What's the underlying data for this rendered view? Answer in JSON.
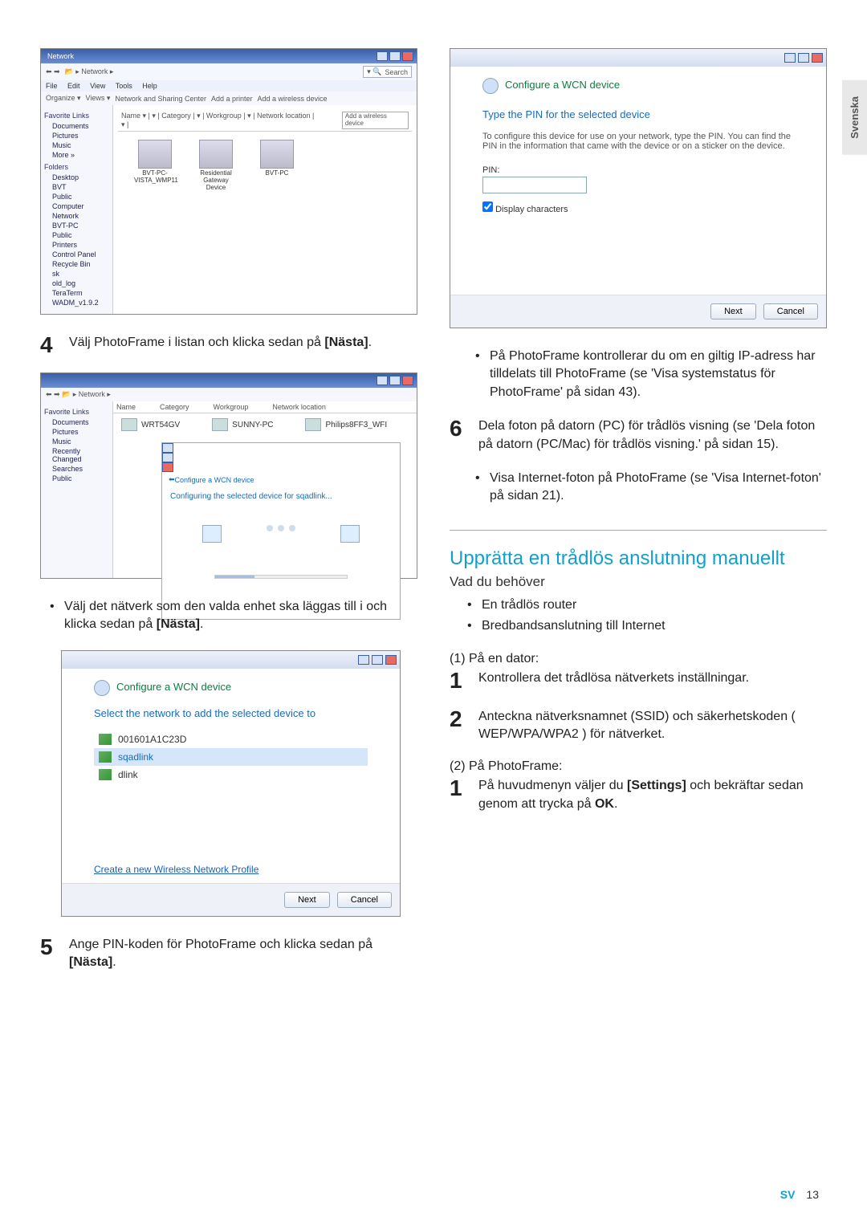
{
  "sidetab": "Svenska",
  "footer": {
    "lang": "SV",
    "page": "13"
  },
  "shot1": {
    "windowtitle": "Network",
    "menubar": [
      "File",
      "Edit",
      "View",
      "Tools",
      "Help"
    ],
    "toolbar_extra": [
      "Organize ▾",
      "Views ▾",
      "Network and Sharing Center",
      "Add a printer",
      "Add a wireless device"
    ],
    "search_placeholder": "Search",
    "headercols": "Name  ▾ | ▾ | Category | ▾ | Workgroup | ▾ | Network location | ▾ |",
    "addbtn": "Add a wireless device",
    "sidebar": {
      "favorites_hd": "Favorite Links",
      "favorites": [
        "Documents",
        "Pictures",
        "Music",
        "More »"
      ],
      "folders_hd": "Folders",
      "folders": [
        "Desktop",
        "BVT",
        "Public",
        "Computer",
        "Network",
        "BVT-PC",
        "Public",
        "Printers",
        "Control Panel",
        "Recycle Bin",
        "sk",
        "old_log",
        "TeraTerm",
        "WADM_v1.9.2"
      ]
    },
    "thumbs": [
      {
        "label": "BVT-PC-",
        "sub": "VISTA_WMP11"
      },
      {
        "label": "Residential Gateway",
        "sub": "Device"
      },
      {
        "label": "BVT-PC",
        "sub": ""
      }
    ]
  },
  "step4": {
    "num": "4",
    "text_a": "Välj PhotoFrame i listan och klicka sedan på ",
    "text_bold": "[Nästa]",
    "text_after": "."
  },
  "shot2": {
    "sidebar": [
      "Documents",
      "Pictures",
      "Music",
      "Recently Changed",
      "Searches",
      "Public"
    ],
    "headercols": [
      "Name",
      "Category",
      "Workgroup",
      "Network location"
    ],
    "items": [
      {
        "name": "WRT54GV"
      },
      {
        "name": "SUNNY-PC"
      },
      {
        "name": "Philips8FF3_WFI"
      }
    ],
    "minidialog_title": "Configure a WCN device",
    "minidialog_body": "Configuring the selected device for sqadlink..."
  },
  "bullet_after4": {
    "text_a": "Välj det nätverk som den valda enhet ska läggas till i och klicka sedan på ",
    "bold": "[Nästa]",
    "after": "."
  },
  "dialog_netlist": {
    "header": "Configure a WCN device",
    "hint": "Select the network to add the selected device to",
    "options": [
      "001601A1C23D",
      "sqadlink",
      "dlink"
    ],
    "link": "Create a new Wireless Network Profile",
    "next": "Next",
    "cancel": "Cancel"
  },
  "step5": {
    "num": "5",
    "text_a": "Ange PIN-koden för PhotoFrame och klicka sedan på ",
    "bold": "[Nästa]",
    "after": "."
  },
  "dialog_pin": {
    "header": "Configure a WCN device",
    "hint": "Type the PIN for the selected device",
    "desc": "To configure this device for use on your network, type the PIN. You can find the PIN in the information that came with the device or on a sticker on the device.",
    "pin_label": "PIN:",
    "chk_label": "Display characters",
    "next": "Next",
    "cancel": "Cancel"
  },
  "right_bullets1": [
    "På PhotoFrame kontrollerar du om en giltig IP-adress har tilldelats till PhotoFrame (se 'Visa systemstatus för PhotoFrame' på sidan 43)."
  ],
  "step6": {
    "num": "6",
    "text": "Dela foton på datorn (PC) för trådlös visning (se 'Dela foton på datorn (PC/Mac) för trådlös visning.' på sidan 15)."
  },
  "right_bullets2": [
    "Visa Internet-foton på PhotoFrame (se 'Visa Internet-foton' på sidan 21)."
  ],
  "section_title": "Upprätta en trådlös anslutning manuellt",
  "need_hd": "Vad du behöver",
  "need_list": [
    "En trådlös router",
    "Bredbandsanslutning till Internet"
  ],
  "sub1_hd": "(1) På en dator:",
  "sub1_steps": [
    {
      "num": "1",
      "text": "Kontrollera det trådlösa nätverkets inställningar."
    },
    {
      "num": "2",
      "text": "Anteckna nätverksnamnet (SSID) och säkerhetskoden ( WEP/WPA/WPA2 ) för nätverket."
    }
  ],
  "sub2_hd": "(2) På PhotoFrame:",
  "sub2_steps": [
    {
      "num": "1",
      "text_a": "På huvudmenyn väljer du ",
      "bold1": "[Settings]",
      "mid": " och bekräftar sedan genom att trycka på ",
      "bold2": "OK",
      "after": "."
    }
  ]
}
